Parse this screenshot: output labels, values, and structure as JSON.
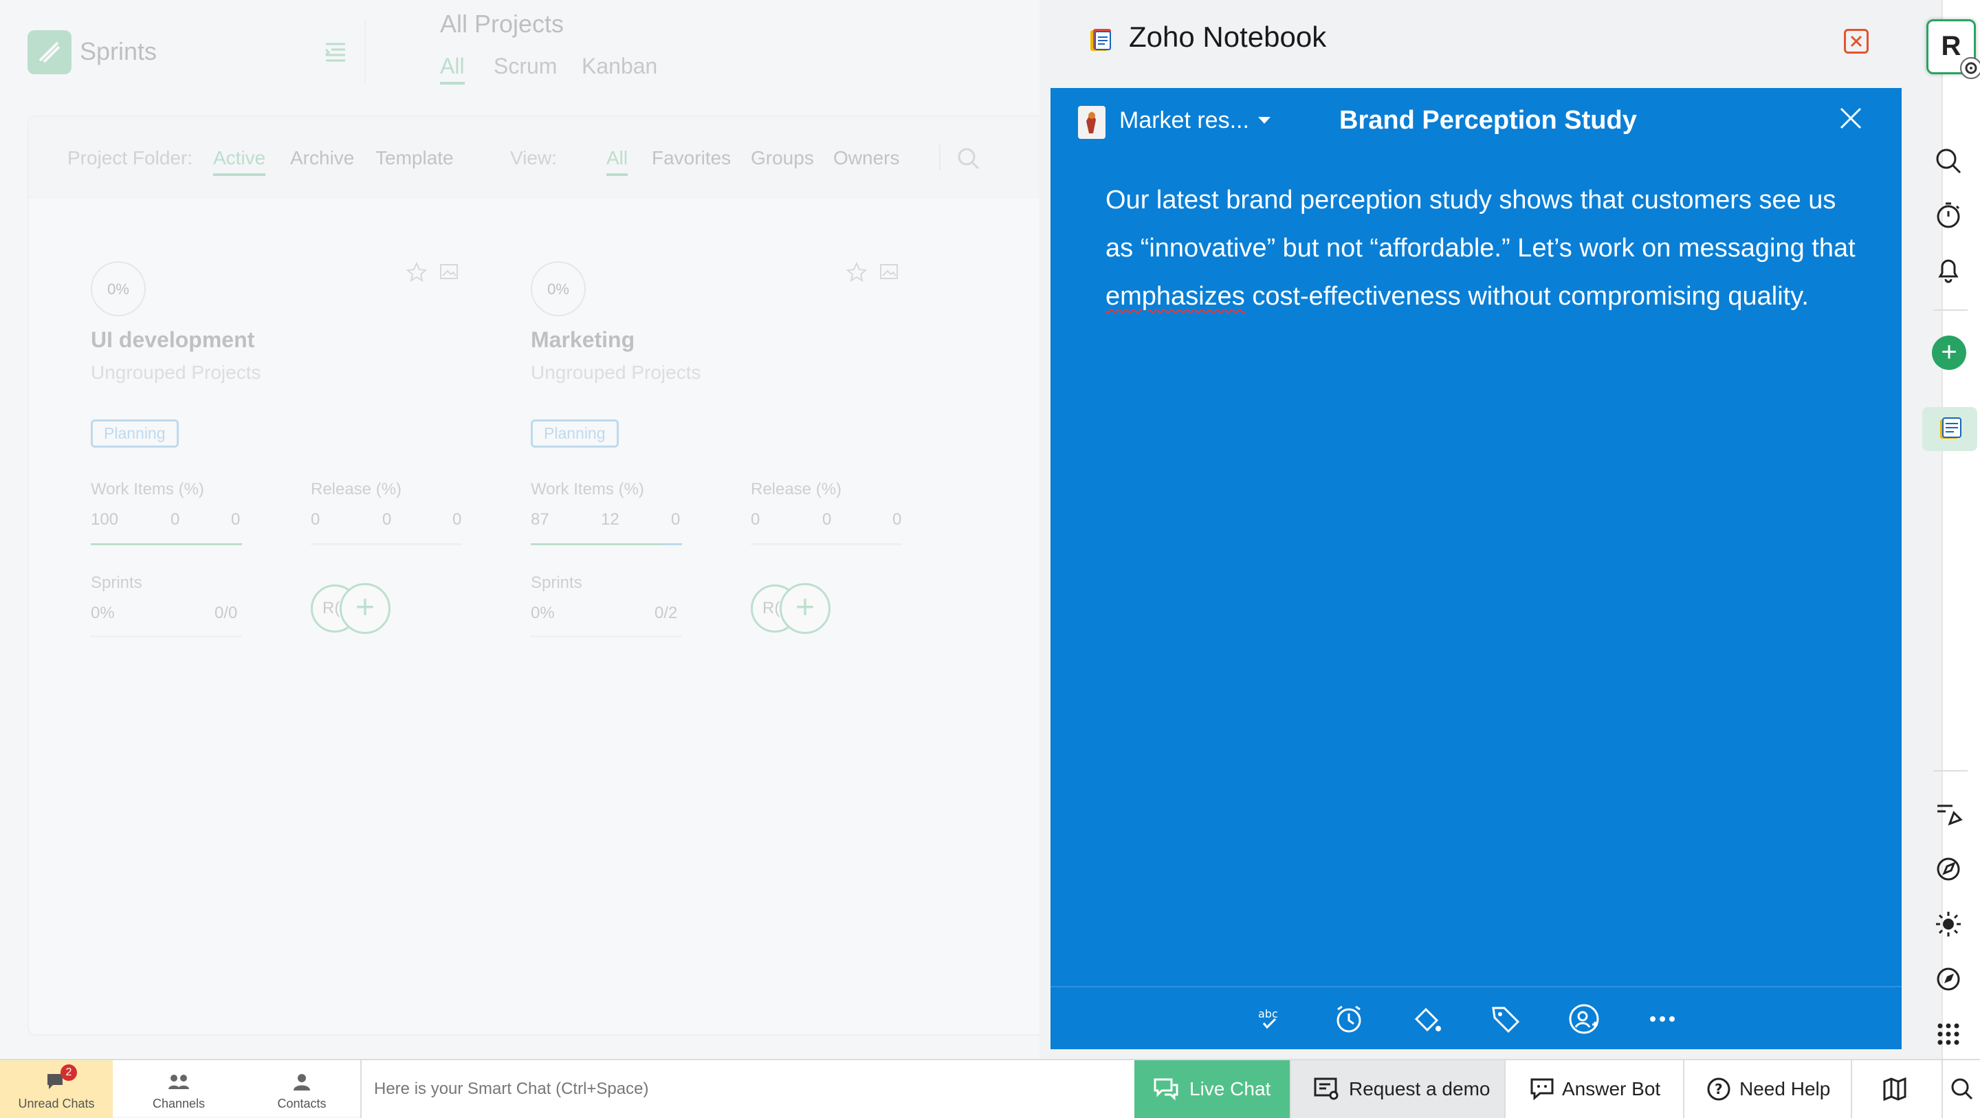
{
  "app": {
    "name": "Sprints",
    "page_title": "All Projects",
    "method_tabs": [
      "All",
      "Scrum",
      "Kanban"
    ],
    "filter": {
      "folder_label": "Project Folder:",
      "folders": [
        "Active",
        "Archive",
        "Template"
      ],
      "view_label": "View:",
      "views": [
        "All",
        "Favorites",
        "Groups",
        "Owners"
      ]
    },
    "projects": [
      {
        "progress": "0%",
        "name": "UI development",
        "group": "Ungrouped Projects",
        "status": "Planning",
        "work_items_label": "Work Items (%)",
        "work_items": [
          "100",
          "0",
          "0"
        ],
        "release_label": "Release (%)",
        "release": [
          "0",
          "0",
          "0"
        ],
        "sprints_label": "Sprints",
        "sprints_pct": "0%",
        "sprints_count": "0/0",
        "avatar": "R("
      },
      {
        "progress": "0%",
        "name": "Marketing",
        "group": "Ungrouped Projects",
        "status": "Planning",
        "work_items_label": "Work Items (%)",
        "work_items": [
          "87",
          "12",
          "0"
        ],
        "release_label": "Release (%)",
        "release": [
          "0",
          "0",
          "0"
        ],
        "sprints_label": "Sprints",
        "sprints_pct": "0%",
        "sprints_count": "0/2",
        "avatar": "R("
      }
    ]
  },
  "notebook": {
    "title": "Zoho Notebook",
    "note": {
      "notebook_label": "Market res...",
      "title": "Brand Perception Study",
      "body_before": "Our latest brand perception study shows that customers see us as “innovative” but not “affordable.” Let’s work on messaging that ",
      "body_flagged": "emphasizes",
      "body_after": " cost-effectiveness without compromising quality.",
      "background_color": "#0a7fd6"
    },
    "toolbar_icons": [
      "spellcheck-icon",
      "reminder-icon",
      "color-fill-icon",
      "tag-icon",
      "share-user-icon",
      "more-icon"
    ]
  },
  "rail": {
    "user_initial": "R",
    "icons": [
      "search-icon",
      "timer-icon",
      "bell-icon",
      "add-icon",
      "notebook-icon",
      "whiteboard-icon",
      "compass-edit-icon",
      "brightness-icon",
      "explore-icon",
      "apps-grid-icon"
    ]
  },
  "bottom_bar": {
    "tabs": [
      {
        "label": "Unread Chats",
        "badge": "2"
      },
      {
        "label": "Channels"
      },
      {
        "label": "Contacts"
      }
    ],
    "smart_chat_placeholder": "Here is your Smart Chat (Ctrl+Space)",
    "buttons": {
      "live_chat": "Live Chat",
      "request_demo": "Request a demo",
      "answer_bot": "Answer Bot",
      "need_help": "Need Help"
    }
  },
  "colors": {
    "accent_green": "#27a463",
    "note_blue": "#0a7fd6",
    "live_chat_green": "#52c08a"
  }
}
